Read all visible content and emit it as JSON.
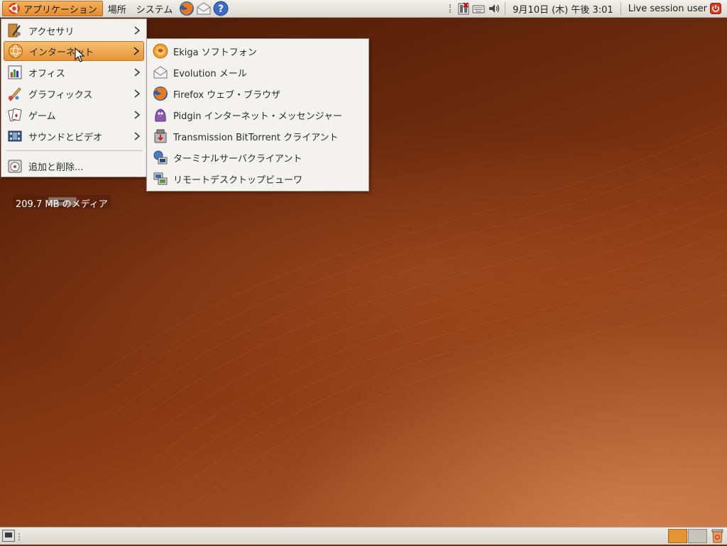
{
  "top_panel": {
    "menus": [
      {
        "label": "アプリケーション",
        "active": true
      },
      {
        "label": "場所"
      },
      {
        "label": "システム"
      }
    ],
    "launchers": [
      "firefox-icon",
      "evolution-mail-icon",
      "help-icon"
    ],
    "tray": {
      "icons": [
        "network-disconnected-icon",
        "keyboard-icon",
        "volume-icon"
      ],
      "clock": "9月10日 (木) 午後 3:01",
      "user": "Live session user",
      "power_icon": "power-icon"
    }
  },
  "app_menu": {
    "items": [
      {
        "label": "アクセサリ",
        "icon": "accessories-icon",
        "has_submenu": true
      },
      {
        "label": "インターネット",
        "icon": "internet-icon",
        "has_submenu": true,
        "highlighted": true
      },
      {
        "label": "オフィス",
        "icon": "office-icon",
        "has_submenu": true
      },
      {
        "label": "グラフィックス",
        "icon": "graphics-icon",
        "has_submenu": true
      },
      {
        "label": "ゲーム",
        "icon": "games-icon",
        "has_submenu": true
      },
      {
        "label": "サウンドとビデオ",
        "icon": "sound-video-icon",
        "has_submenu": true
      }
    ],
    "footer_item": {
      "label": "追加と削除...",
      "icon": "add-remove-icon"
    }
  },
  "internet_submenu": {
    "items": [
      {
        "label": "Ekiga ソフトフォン",
        "icon": "ekiga-icon"
      },
      {
        "label": "Evolution メール",
        "icon": "evolution-mail-icon"
      },
      {
        "label": "Firefox ウェブ・ブラウザ",
        "icon": "firefox-icon"
      },
      {
        "label": "Pidgin インターネット・メッセンジャー",
        "icon": "pidgin-icon"
      },
      {
        "label": "Transmission BitTorrent クライアント",
        "icon": "transmission-icon"
      },
      {
        "label": "ターミナルサーバクライアント",
        "icon": "terminal-server-client-icon"
      },
      {
        "label": "リモートデスクトップビューワ",
        "icon": "remote-desktop-viewer-icon"
      }
    ]
  },
  "desktop": {
    "volume_label": "209.7 MB のメディア",
    "volume_icon": "drive-icon"
  },
  "bottom_panel": {
    "workspaces": [
      "workspace-1",
      "workspace-2"
    ],
    "trash_icon": "trash-icon",
    "show_desktop_icon": "show-desktop-icon"
  },
  "colors": {
    "accent": "#e38b2f",
    "wallpaper_dark": "#4a1a06",
    "wallpaper_light": "#b8683a",
    "panel": "#e8e5df"
  }
}
